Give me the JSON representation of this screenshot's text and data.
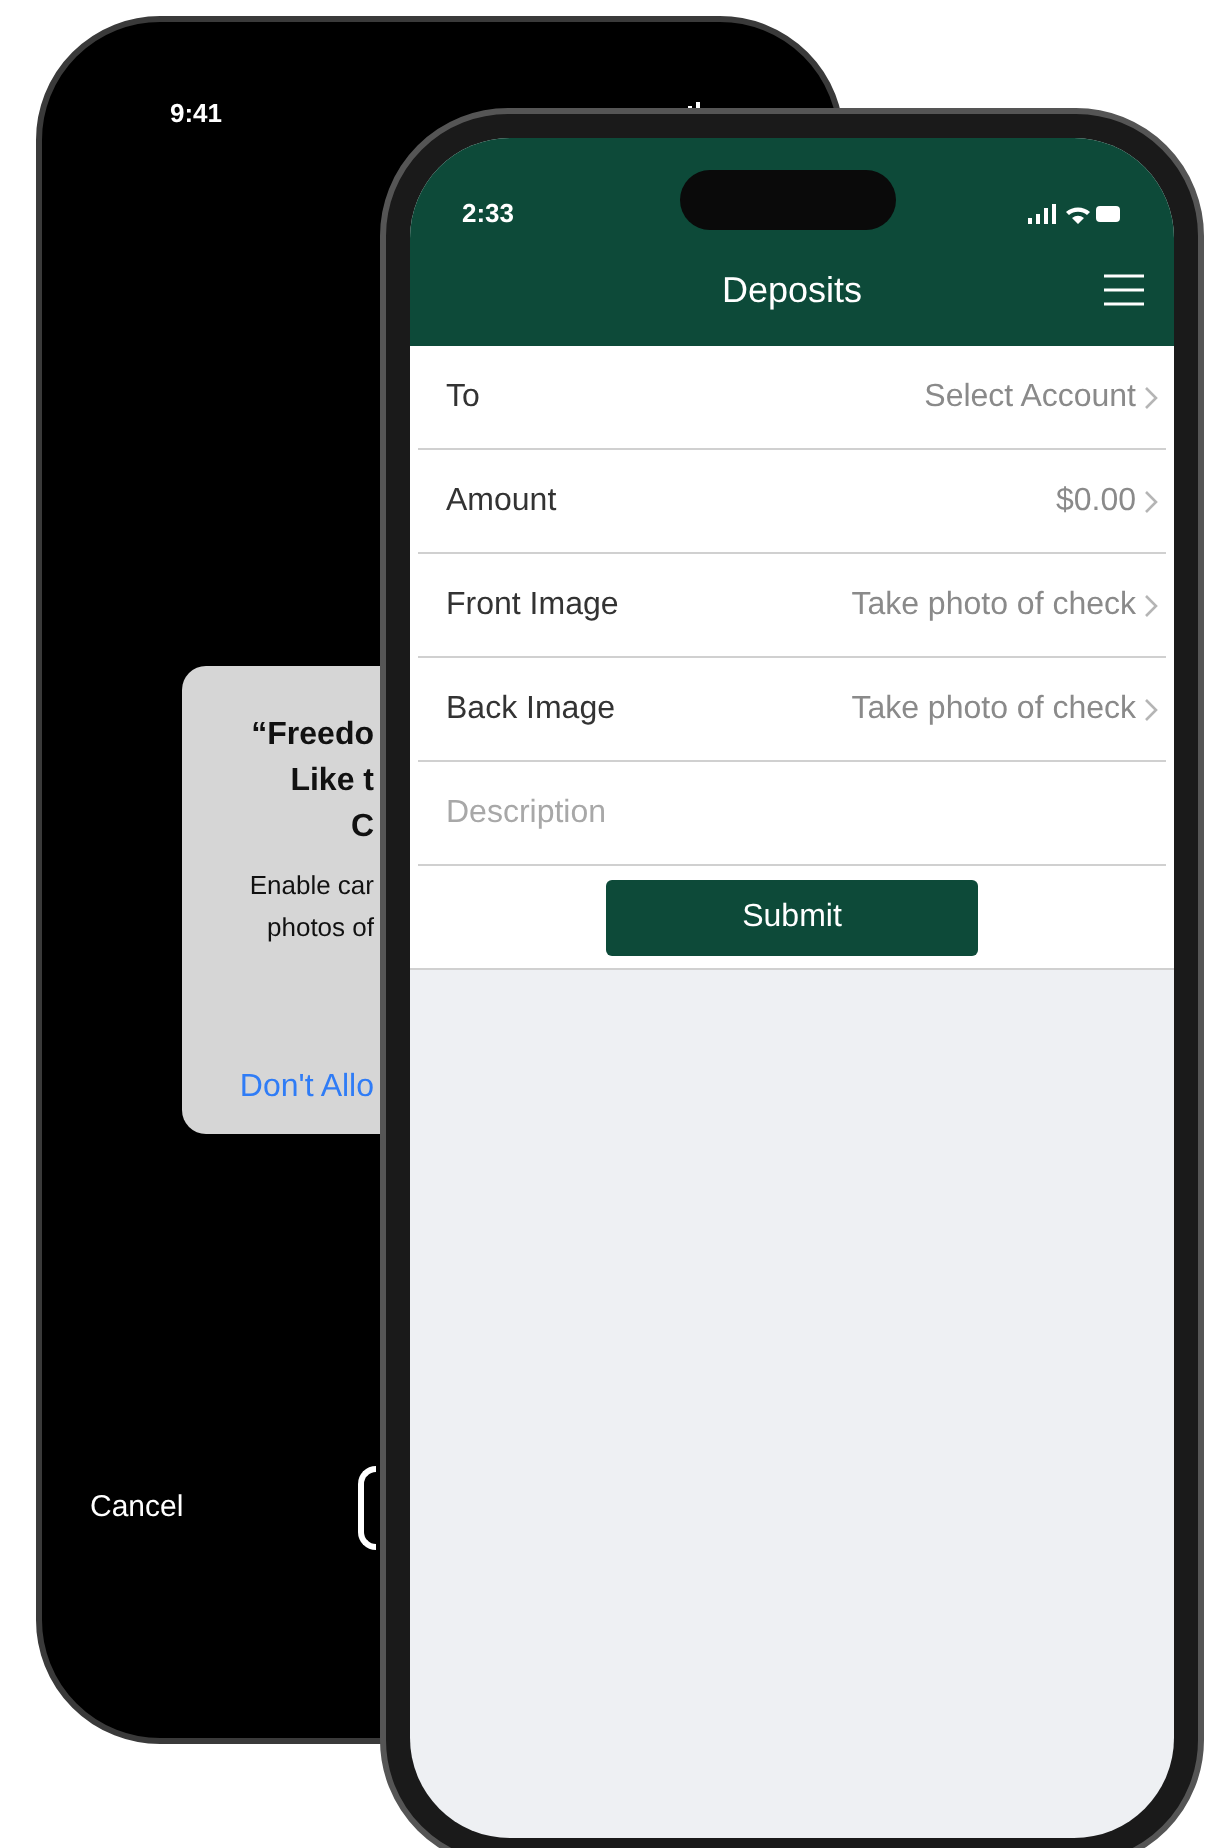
{
  "back_phone": {
    "status_bar": {
      "time": "9:41"
    },
    "alert": {
      "title_lines": [
        "“Freedo",
        "Like t",
        "C"
      ],
      "message_lines": [
        "Enable car",
        "photos of"
      ],
      "button": "Don't Allo"
    },
    "cancel": "Cancel"
  },
  "front_phone": {
    "status_bar": {
      "time": "2:33"
    },
    "title": "Deposits",
    "rows": [
      {
        "kind": "select",
        "label": "To",
        "value": "Select Account"
      },
      {
        "kind": "select",
        "label": "Amount",
        "value": "$0.00"
      },
      {
        "kind": "select",
        "label": "Front Image",
        "value": "Take photo of check"
      },
      {
        "kind": "select",
        "label": "Back Image",
        "value": "Take photo of check"
      },
      {
        "kind": "input",
        "placeholder": "Description"
      }
    ],
    "submit": "Submit"
  }
}
